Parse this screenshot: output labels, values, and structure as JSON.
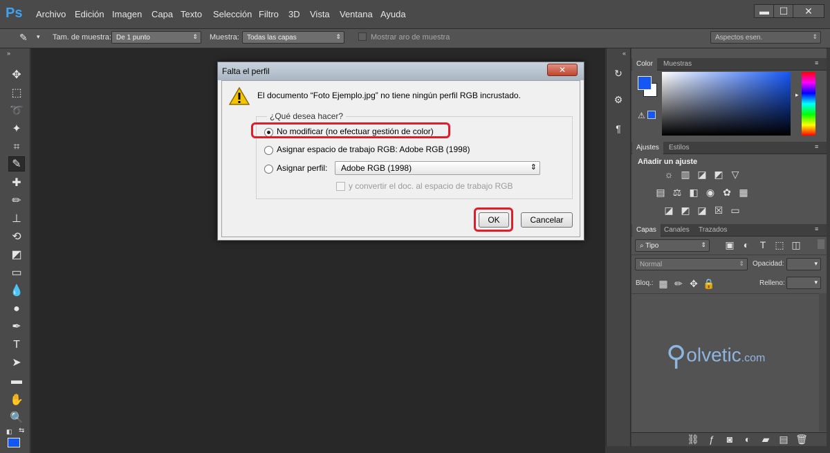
{
  "app": {
    "logo": "Ps",
    "menu": [
      "Archivo",
      "Edición",
      "Imagen",
      "Capa",
      "Texto",
      "Selección",
      "Filtro",
      "3D",
      "Vista",
      "Ventana",
      "Ayuda"
    ],
    "window_controls": [
      "▬",
      "☐",
      "✕"
    ]
  },
  "options_bar": {
    "sample_size_label": "Tam. de muestra:",
    "sample_size_value": "De 1 punto",
    "sample_label": "Muestra:",
    "sample_value": "Todas las capas",
    "show_ring_label": "Mostrar aro de muestra",
    "workspace_value": "Aspectos esen."
  },
  "color_panel": {
    "tabs": [
      "Color",
      "Muestras"
    ]
  },
  "adjust_panel": {
    "tabs": [
      "Ajustes",
      "Estilos"
    ],
    "title": "Añadir un ajuste"
  },
  "layers_panel": {
    "tabs": [
      "Capas",
      "Canales",
      "Trazados"
    ],
    "filter_value": "Tipo",
    "blend_value": "Normal",
    "opacity_label": "Opacidad:",
    "lock_label": "Bloq.:",
    "fill_label": "Relleno:"
  },
  "dialog": {
    "title": "Falta el perfil",
    "close": "✕",
    "message": "El documento “Foto Ejemplo.jpg” no tiene ningún perfil RGB incrustado.",
    "question": "¿Qué desea hacer?",
    "option1": "No modificar (no efectuar gestión de color)",
    "option2": "Asignar espacio de trabajo RGB: Adobe RGB (1998)",
    "option3": "Asignar perfil:",
    "profile_value": "Adobe RGB (1998)",
    "convert_label": "y convertir el doc. al espacio de trabajo RGB",
    "ok": "OK",
    "cancel": "Cancelar"
  },
  "watermark": {
    "brand": "olvetic",
    "suffix": ".com"
  }
}
